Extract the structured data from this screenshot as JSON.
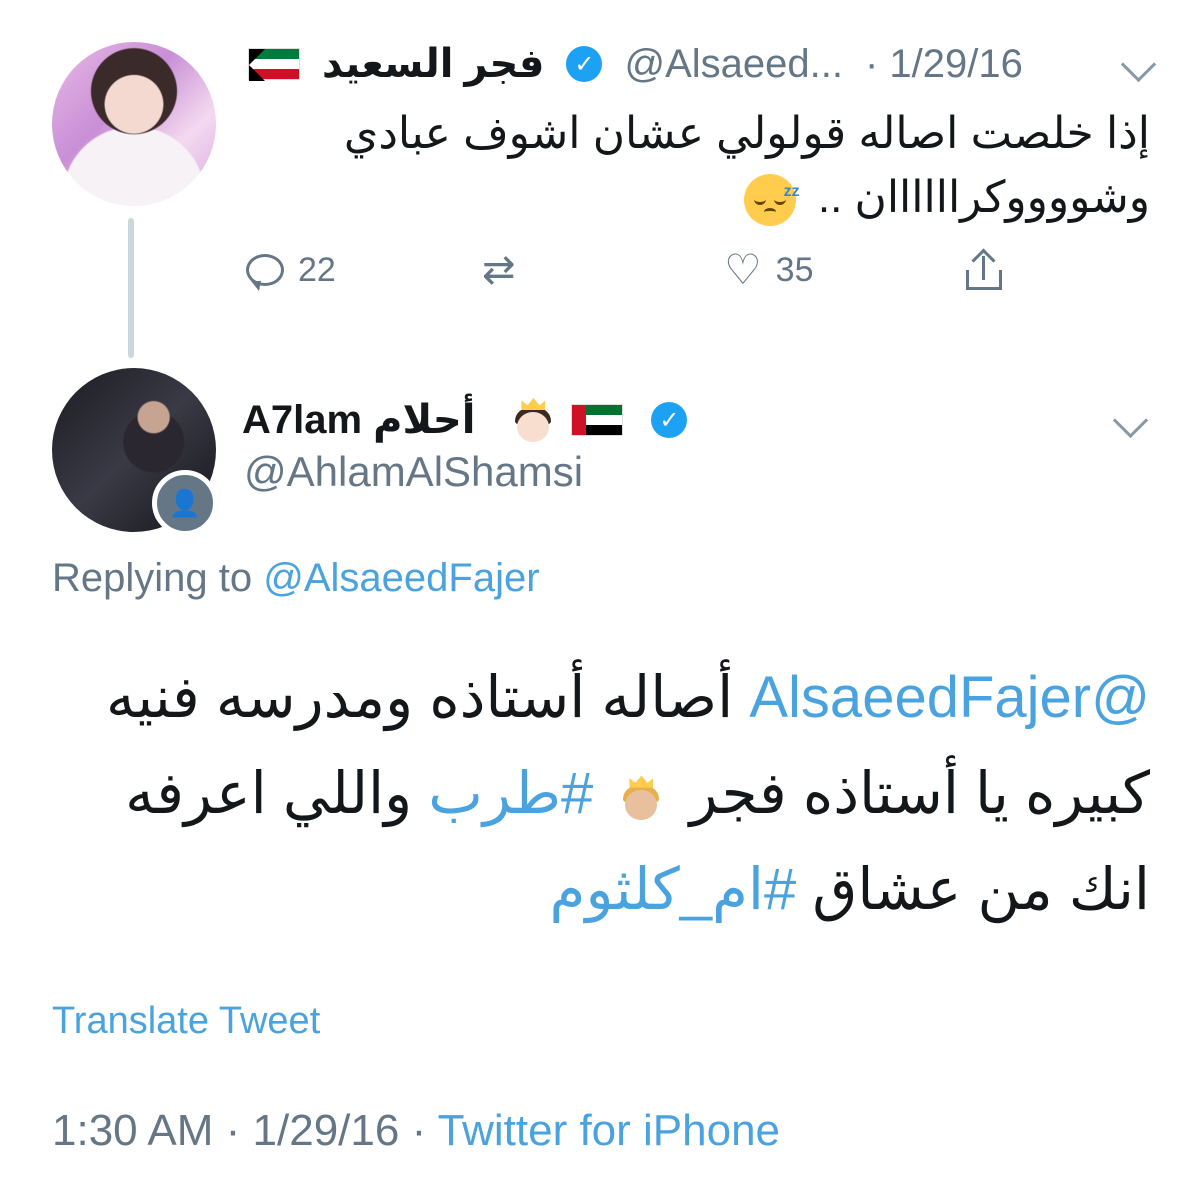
{
  "tweet1": {
    "name": "فجر السعيد",
    "handle": "@Alsaeed...",
    "date": "· 1/29/16",
    "text_line1": "إذا خلصت اصاله قولولي عشان اشوف عبادي",
    "text_line2": "وشووووكراااااان ..",
    "reply_count": "22",
    "like_count": "35",
    "icons": [
      "kuwait-flag-icon",
      "verified-icon",
      "chevron-down-icon",
      "sleeping-face-emoji",
      "reply-icon",
      "retweet-icon",
      "like-icon",
      "share-icon"
    ]
  },
  "tweet2": {
    "name": "A7lam أحلام",
    "handle": "@AhlamAlShamsi",
    "replying_label": "Replying to",
    "replying_handle": "@AlsaeedFajer",
    "mention": "@AlsaeedFajer",
    "text_a": "أصاله أستاذه ومدرسه فنيه",
    "text_b": "كبيره يا أستاذه فجر",
    "hashtag1": "#طرب",
    "text_c": "واللي اعرفه",
    "text_d": "انك من عشاق",
    "hashtag2": "#ام_كلثوم",
    "translate": "Translate Tweet",
    "time": "1:30 AM · 1/29/16 ·",
    "source": "Twitter for iPhone",
    "icons": [
      "princess-emoji",
      "uae-flag-icon",
      "verified-icon",
      "follow-badge-icon",
      "chevron-down-icon"
    ]
  },
  "colors": {
    "link": "#4aa3df",
    "muted": "#657786",
    "verified": "#1da1f2"
  }
}
